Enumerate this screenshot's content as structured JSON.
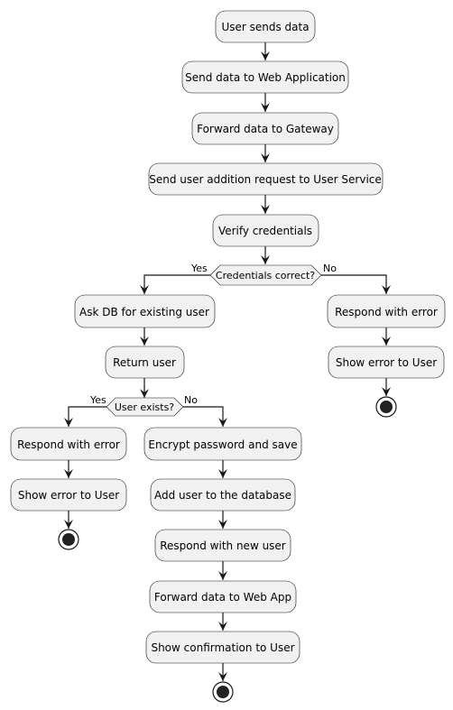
{
  "nodes": {
    "n1": "User sends data",
    "n2": "Send data to Web Application",
    "n3": "Forward data to Gateway",
    "n4": "Send user addition request to User Service",
    "n5": "Verify credentials",
    "n6": "Ask DB for existing user",
    "n7": "Return user",
    "n8": "Respond with error",
    "n9": "Show error to User",
    "n10": "Respond with error",
    "n11": "Show error to User",
    "n12": "Encrypt password and save",
    "n13": "Add user to the database",
    "n14": "Respond with new user",
    "n15": "Forward data to Web App",
    "n16": "Show confirmation to User"
  },
  "decisions": {
    "d1": {
      "label": "Credentials correct?",
      "yes": "Yes",
      "no": "No"
    },
    "d2": {
      "label": "User exists?",
      "yes": "Yes",
      "no": "No"
    }
  }
}
